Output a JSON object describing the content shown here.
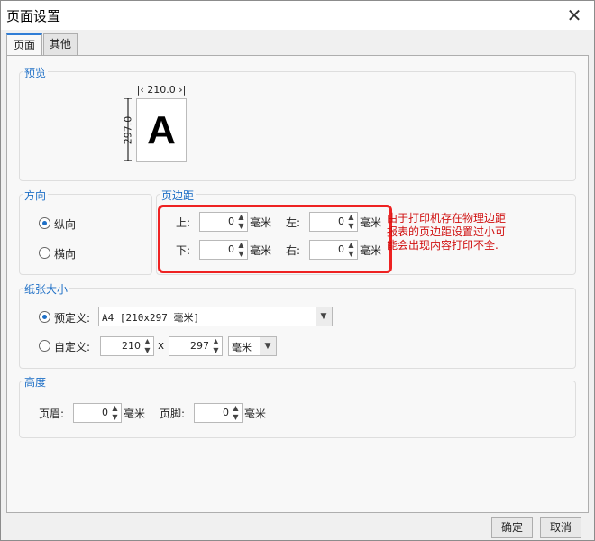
{
  "dialog": {
    "title": "页面设置",
    "close_glyph": "✕"
  },
  "tabs": [
    {
      "label": "页面",
      "active": true
    },
    {
      "label": "其他",
      "active": false
    }
  ],
  "preview": {
    "label": "预览",
    "width_text": "210.0",
    "height_text": "297.0",
    "letter": "A"
  },
  "orientation": {
    "label": "方向",
    "portrait": "纵向",
    "landscape": "横向",
    "selected": "portrait"
  },
  "margins": {
    "label": "页边距",
    "top_label": "上:",
    "top_value": "0",
    "top_unit": "毫米",
    "left_label": "左:",
    "left_value": "0",
    "left_unit": "毫米",
    "bottom_label": "下:",
    "bottom_value": "0",
    "bottom_unit": "毫米",
    "right_label": "右:",
    "right_value": "0",
    "right_unit": "毫米"
  },
  "warning": {
    "text": "由于打印机存在物理边距报表的页边距设置过小可能会出现内容打印不全.",
    "color": "#d01010"
  },
  "paper": {
    "label": "纸张大小",
    "predefined_label": "预定义:",
    "predefined_value": "A4 [210x297 毫米]",
    "custom_label": "自定义:",
    "custom_width": "210",
    "times": "x",
    "custom_height": "297",
    "unit": "毫米",
    "selected": "predefined"
  },
  "height": {
    "label": "高度",
    "header_label": "页眉:",
    "header_value": "0",
    "header_unit": "毫米",
    "footer_label": "页脚:",
    "footer_value": "0",
    "footer_unit": "毫米"
  },
  "buttons": {
    "ok": "确定",
    "cancel": "取消"
  },
  "colors": {
    "accent": "#1e6fc6",
    "warning_border": "#ee2222"
  }
}
